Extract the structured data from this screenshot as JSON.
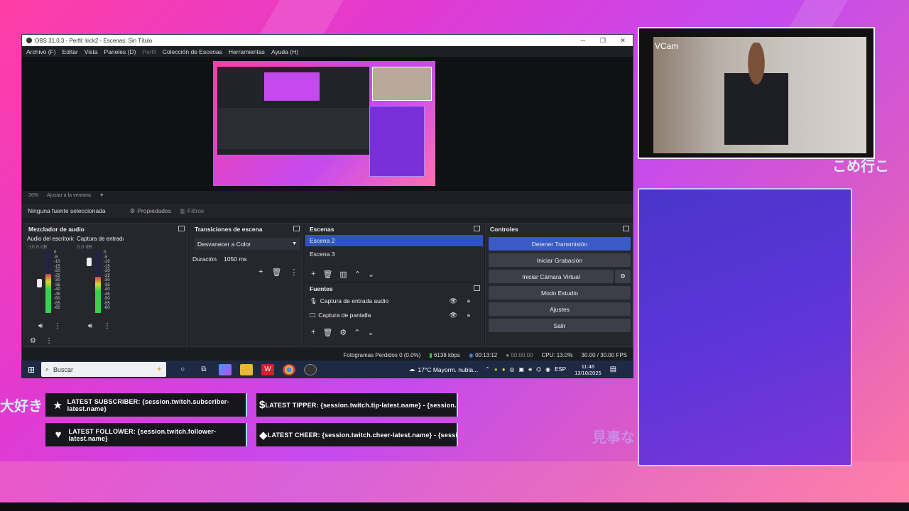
{
  "obs": {
    "title": "OBS 31.0.3 - Perfil: kick2 - Escenas: Sin Título",
    "menu": [
      "Archivo (F)",
      "Editar",
      "Vista",
      "Paneles (D)",
      "Perfil",
      "Colección de Escenas",
      "Herramientas",
      "Ayuda (H)"
    ],
    "zoom": "26%",
    "zoom_mode": "Ajustar a la ventana",
    "no_source": "Ninguna fuente seleccionada",
    "properties": "Propiedades",
    "filters": "Filtros",
    "mixer": {
      "title": "Mezclador de audio",
      "channels": [
        {
          "name": "Audio del escritorio",
          "db": "-10.6 dB",
          "level": 0.62
        },
        {
          "name": "Captura de entrada audio",
          "db": "0.0 dB",
          "level": 0.58
        }
      ],
      "scale": [
        "0",
        "-5",
        "-10",
        "-15",
        "-20",
        "-25",
        "-30",
        "-35",
        "-40",
        "-45",
        "-50",
        "-55",
        "-60"
      ]
    },
    "transitions": {
      "title": "Transiciones de escena",
      "selected": "Desvanecer a Color",
      "duration_label": "Duración",
      "duration_value": "1050 ms"
    },
    "scenes": {
      "title": "Escenas",
      "items": [
        "Escena 2",
        "Escena 3"
      ],
      "active": "Escena 2"
    },
    "sources": {
      "title": "Fuentes",
      "items": [
        "Captura de entrada audio",
        "Captura de pantalla"
      ]
    },
    "controls": {
      "title": "Controles",
      "stop_stream": "Detener Transmisión",
      "start_record": "Iniciar Grabación",
      "virtual_cam": "Iniciar Cámara Virtual",
      "studio": "Modo Estudio",
      "settings": "Ajustes",
      "exit": "Salir"
    },
    "status": {
      "dropped": "Fotogramas Perdidos 0 (0.0%)",
      "bitrate": "6138 kbps",
      "live_time": "00:13:12",
      "rec_time": "00:00:00",
      "cpu": "CPU: 13.0%",
      "fps": "30.00 / 30.00 FPS"
    }
  },
  "taskbar": {
    "search": "Buscar",
    "weather": "17°C  Mayorm. nubla...",
    "lang": "ESP",
    "time": "11:46",
    "date": "13/10/2025"
  },
  "webcam": {
    "label": "VCam"
  },
  "overlay": {
    "jp_right": "こめ行こ",
    "jp_left": "大好き",
    "jp_bottom": "見事な",
    "alerts": [
      {
        "icon": "★",
        "text": "LATEST SUBSCRIBER: {session.twitch.subscriber-latest.name}"
      },
      {
        "icon": "$",
        "text": "LATEST TIPPER: {session.twitch.tip-latest.name} - {session.twitch.tip-latest.amount}"
      },
      {
        "icon": "♥",
        "text": "LATEST FOLLOWER: {session.twitch.follower-latest.name}"
      },
      {
        "icon": "◆",
        "text": "LATEST CHEER: {session.twitch.cheer-latest.name} - {session.twitch.cheer-latest.amount}"
      }
    ]
  }
}
